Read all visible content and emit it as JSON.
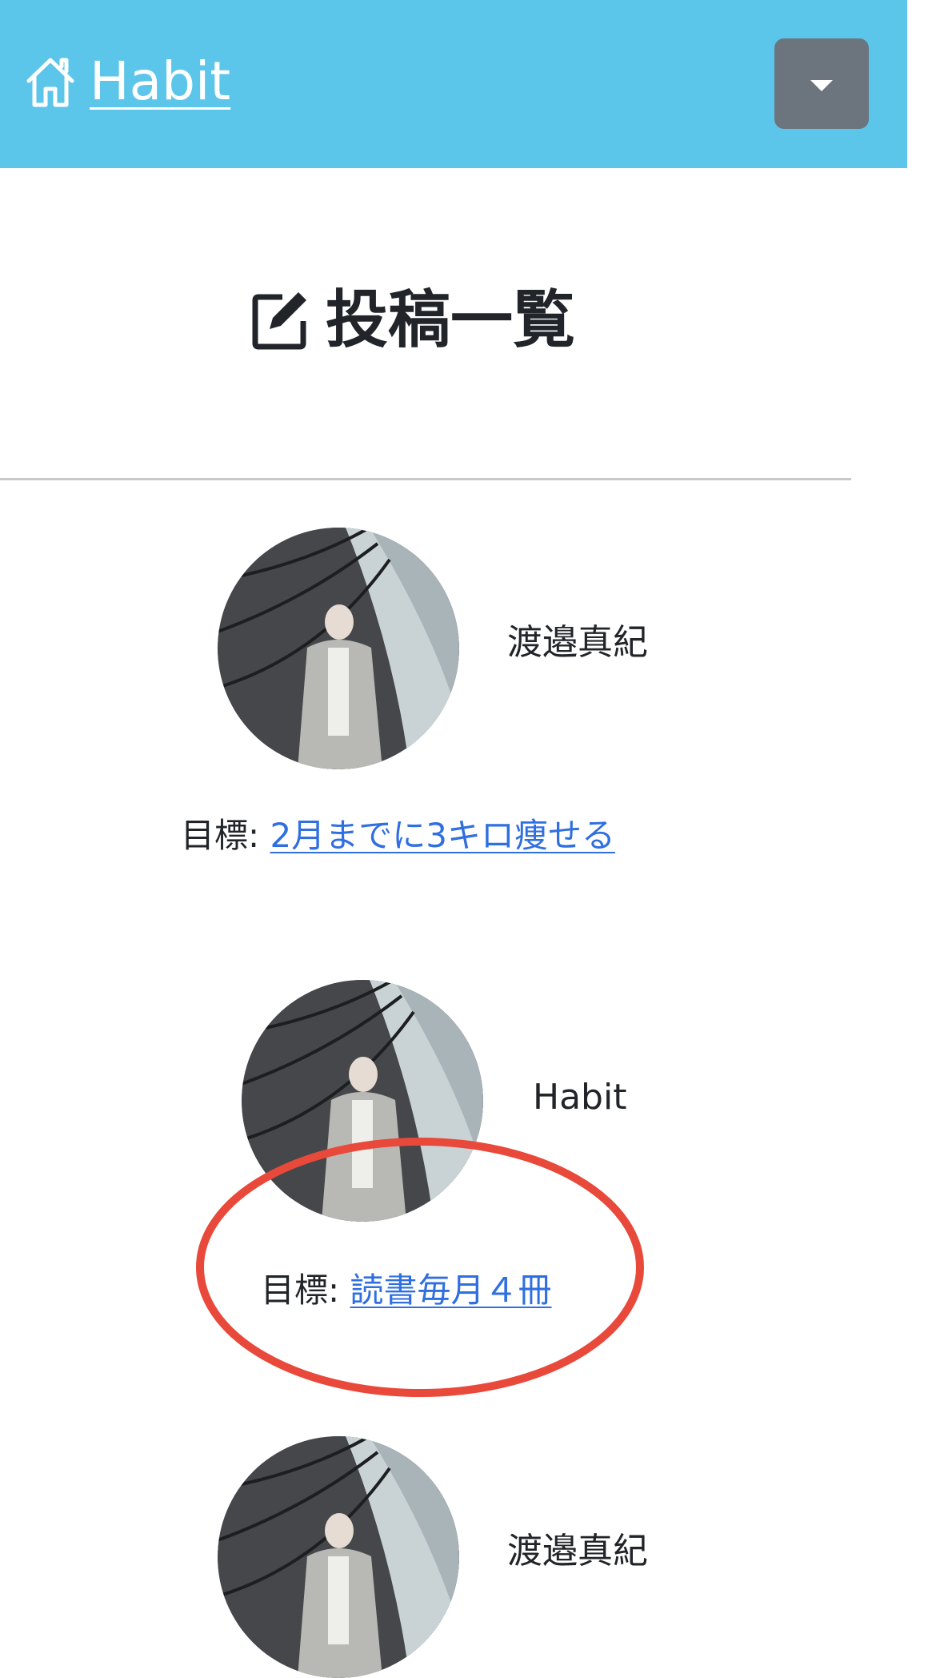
{
  "navbar": {
    "brand_label": "Habit",
    "brand_icon": "home-icon",
    "dropdown_icon": "caret-down-icon",
    "background_color": "#5bc5ea",
    "button_color": "#6c757d"
  },
  "page": {
    "title": "投稿一覧",
    "title_icon": "edit-icon"
  },
  "posts": [
    {
      "username": "渡邉真紀",
      "goal_label": "目標:",
      "goal_link": "2月までに3キロ痩せる"
    },
    {
      "username": "Habit",
      "goal_label": "目標:",
      "goal_link": "読書毎月４冊"
    },
    {
      "username": "渡邉真紀"
    }
  ],
  "annotation": {
    "color": "#e8493a"
  },
  "colors": {
    "link": "#2f6fe0",
    "text": "#212529"
  }
}
